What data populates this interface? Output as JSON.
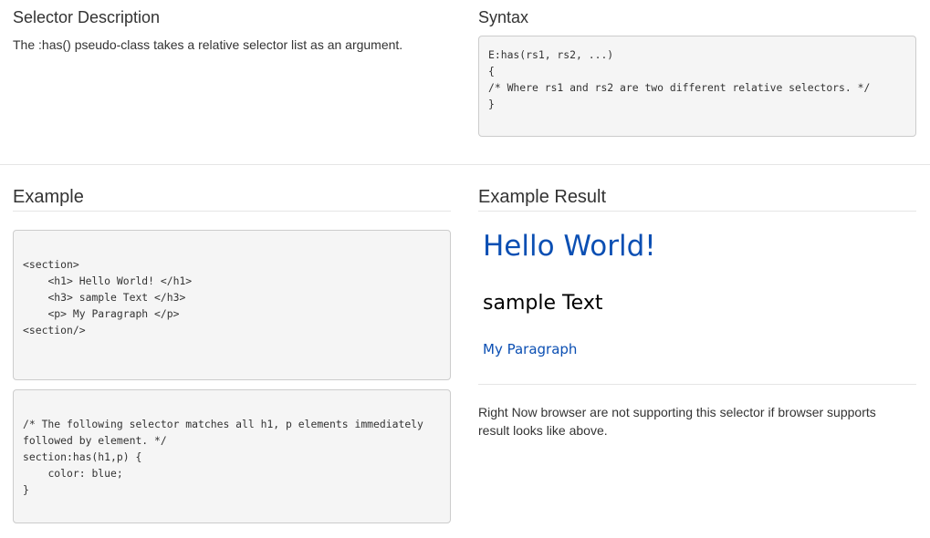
{
  "selector_description": {
    "title": "Selector Description",
    "text": "The :has() pseudo-class takes a relative selector list as an argument."
  },
  "syntax": {
    "title": "Syntax",
    "code": "E:has(rs1, rs2, ...)\n{\n/* Where rs1 and rs2 are two different relative selectors. */\n}"
  },
  "example": {
    "title": "Example",
    "html_code": "<section>\n    <h1> Hello World! </h1>\n    <h3> sample Text </h3>\n    <p> My Paragraph </p>\n<section/>",
    "css_code": "/* The following selector matches all h1, p elements immediately followed by element. */\nsection:has(h1,p) {\n    color: blue;\n}"
  },
  "example_result": {
    "title": "Example Result",
    "h1": "Hello World!",
    "h3": "sample Text",
    "p": "My Paragraph",
    "note": "Right Now browser are not supporting this selector if browser supports result looks like above.",
    "highlight_color": "#0b4fb3"
  }
}
